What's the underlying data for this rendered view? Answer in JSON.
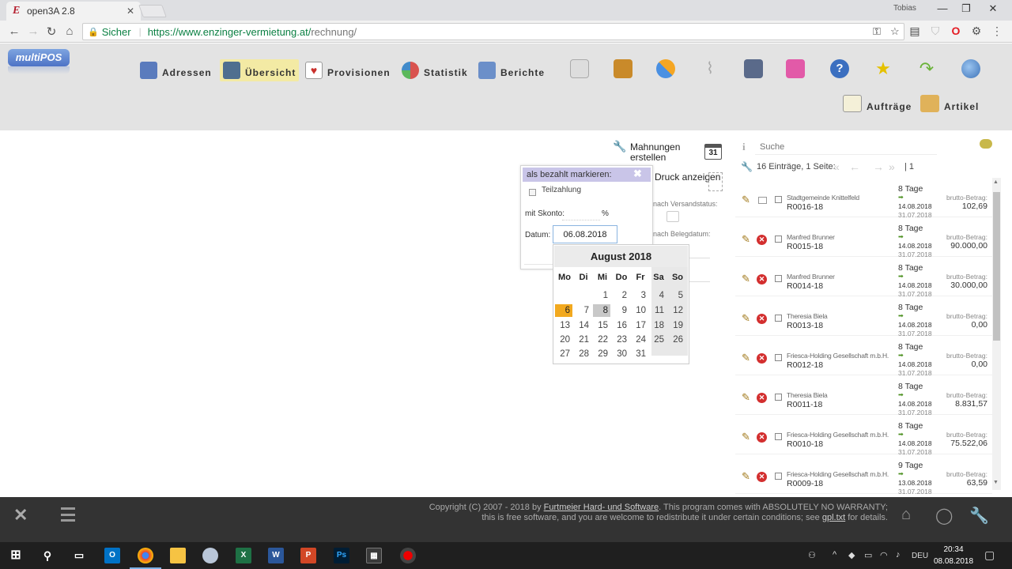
{
  "browser": {
    "tab_title": "open3A 2.8",
    "tab_favicon": "E",
    "profile_name": "Tobias",
    "secure_label": "Sicher",
    "url_host": "https://www.enzinger-vermietung.at/",
    "url_path": "rechnung/"
  },
  "app": {
    "logo_text": "multiPOS",
    "menu": [
      {
        "label": "Adressen",
        "icon": "address-book-icon",
        "color": "#5a7bbd"
      },
      {
        "label": "Übersicht",
        "icon": "overview-icon",
        "color": "#4f6f8f"
      },
      {
        "label": "Provisionen",
        "icon": "cards-icon",
        "color": "#c9302c"
      },
      {
        "label": "Statistik",
        "icon": "pie-chart-icon",
        "color": "#d9534f"
      },
      {
        "label": "Berichte",
        "icon": "folder-icon",
        "color": "#6b8fc9"
      }
    ],
    "submenu": [
      {
        "label": "Aufträge",
        "icon": "orders-icon"
      },
      {
        "label": "Artikel",
        "icon": "articles-icon"
      }
    ]
  },
  "middle": {
    "mahnungen": "Mahnungen erstellen",
    "calendar_badge": "31",
    "druck": "Druck anzeigen",
    "versand": "nach Versandstatus:",
    "belegdatum": "nach Belegdatum:"
  },
  "popup": {
    "title": "als bezahlt markieren:",
    "teilzahlung": "Teilzahlung",
    "skonto_label": "mit Skonto:",
    "skonto_value": "",
    "percent": "%",
    "datum_label": "Datum:",
    "datum_value": "06.08.2018"
  },
  "calendar": {
    "title": "August 2018",
    "weekdays": [
      "Mo",
      "Di",
      "Mi",
      "Do",
      "Fr",
      "Sa",
      "So"
    ],
    "selected_day": "6",
    "today_day": "8"
  },
  "list": {
    "search_placeholder": "Suche",
    "entries": "16 Einträge, 1 Seite:",
    "page": "| 1",
    "rows": [
      {
        "name": "Stadtgemeinde Knittelfeld",
        "number": "R0016-18",
        "days": "8 Tage",
        "date1": "14.08.2018",
        "date2": "31.07.2018",
        "brutto_label": "brutto-Betrag:",
        "brutto": "102,69",
        "status": "sent"
      },
      {
        "name": "Manfred Brunner",
        "number": "R0015-18",
        "days": "8 Tage",
        "date1": "14.08.2018",
        "date2": "31.07.2018",
        "brutto_label": "brutto-Betrag:",
        "brutto": "90.000,00",
        "status": "open"
      },
      {
        "name": "Manfred Brunner",
        "number": "R0014-18",
        "days": "8 Tage",
        "date1": "14.08.2018",
        "date2": "31.07.2018",
        "brutto_label": "brutto-Betrag:",
        "brutto": "30.000,00",
        "status": "open"
      },
      {
        "name": "Theresia Biela",
        "number": "R0013-18",
        "days": "8 Tage",
        "date1": "14.08.2018",
        "date2": "31.07.2018",
        "brutto_label": "brutto-Betrag:",
        "brutto": "0,00",
        "status": "open"
      },
      {
        "name": "Friesca-Holding Gesellschaft m.b.H.",
        "number": "R0012-18",
        "days": "8 Tage",
        "date1": "14.08.2018",
        "date2": "31.07.2018",
        "brutto_label": "brutto-Betrag:",
        "brutto": "0,00",
        "status": "open"
      },
      {
        "name": "Theresia Biela",
        "number": "R0011-18",
        "days": "8 Tage",
        "date1": "14.08.2018",
        "date2": "31.07.2018",
        "brutto_label": "brutto-Betrag:",
        "brutto": "8.831,57",
        "status": "open"
      },
      {
        "name": "Friesca-Holding Gesellschaft m.b.H.",
        "number": "R0010-18",
        "days": "8 Tage",
        "date1": "14.08.2018",
        "date2": "31.07.2018",
        "brutto_label": "brutto-Betrag:",
        "brutto": "75.522,06",
        "status": "open"
      },
      {
        "name": "Friesca-Holding Gesellschaft m.b.H.",
        "number": "R0009-18",
        "days": "9 Tage",
        "date1": "13.08.2018",
        "date2": "31.07.2018",
        "brutto_label": "brutto-Betrag:",
        "brutto": "63,59",
        "status": "open"
      }
    ]
  },
  "footer": {
    "line1_pre": "Copyright (C) 2007 - 2018 by ",
    "line1_link": "Furtmeier Hard- und Software",
    "line1_post": ". This program comes with ABSOLUTELY NO WARRANTY;",
    "line2_pre": "this is free software, and you are welcome to redistribute it under certain conditions; see ",
    "line2_link": "gpl.txt",
    "line2_post": " for details."
  },
  "taskbar": {
    "language": "DEU",
    "time": "20:34",
    "date": "08.08.2018"
  }
}
